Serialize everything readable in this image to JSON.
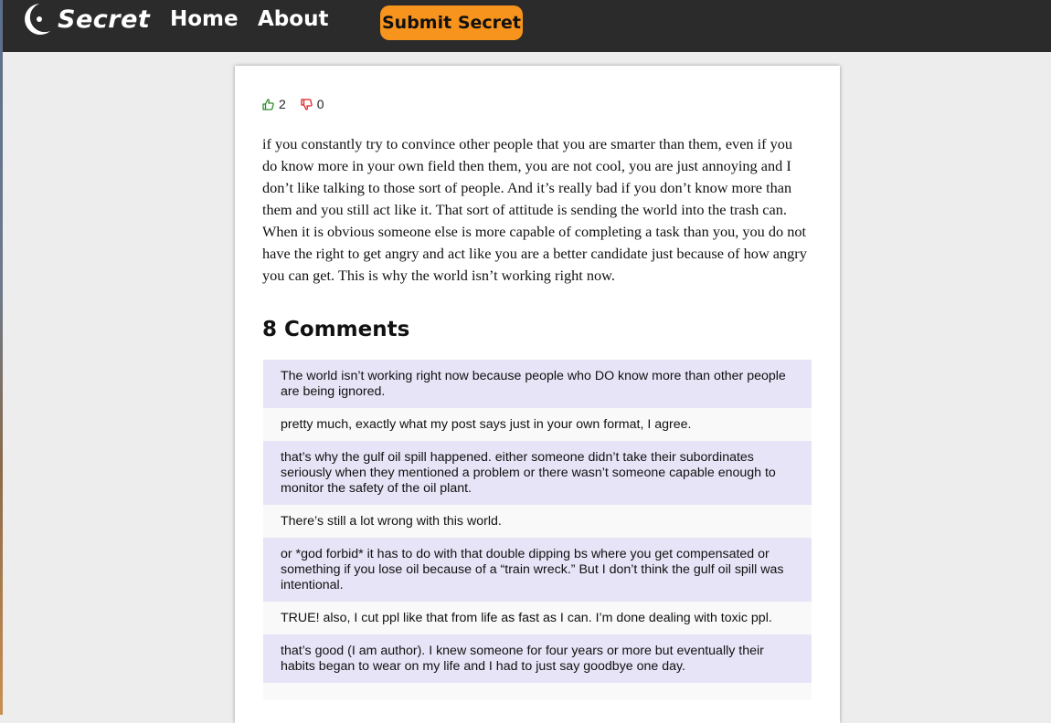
{
  "nav": {
    "logo_text": "Secret",
    "home": "Home",
    "about": "About",
    "submit": "Submit Secret"
  },
  "post": {
    "upvotes": "2",
    "downvotes": "0",
    "body": "if you constantly try to convince other people that you are smarter than them, even if you do know more in your own field then them, you are not cool, you are just annoying and I don’t like talking to those sort of people. And it’s really bad if you don’t know more than them and you still act like it. That sort of attitude is sending the world into the trash can. When it is obvious someone else is more capable of completing a task than you, you do not have the right to get angry and act like you are a better candidate just because of how angry you can get. This is why the world isn’t working right now."
  },
  "comments": {
    "count": "8",
    "label": "Comments",
    "items": [
      "The world isn’t working right now because people who DO know more than other people are being ignored.",
      "pretty much, exactly what my post says just in your own format, I agree.",
      "that’s why the gulf oil spill happened. either someone didn’t take their subordinates seriously when they mentioned a problem or there wasn’t someone capable enough to monitor the safety of the oil plant.",
      "There’s still a lot wrong with this world.",
      "or *god forbid* it has to do with that double dipping bs where you get compensated or something if you lose oil because of a “train wreck.” But I don’t think the gulf oil spill was intentional.",
      "TRUE! also, I cut ppl like that from life as fast as I can. I’m done dealing with toxic ppl.",
      "that’s good (I am author). I knew someone for four years or more but eventually their habits began to wear on my life and I had to just say goodbye one day.",
      ""
    ]
  },
  "colors": {
    "navbar": "#2b2b2b",
    "submit_button": "#f7941d",
    "comment_odd": "#e6e4f6",
    "comment_even": "#f9f9f9",
    "upvote_icon": "#2e8b2e",
    "downvote_icon": "#e02020"
  },
  "icons": {
    "logo": "crescent-logo-icon",
    "upvote": "thumbs-up-icon",
    "downvote": "thumbs-down-icon"
  }
}
